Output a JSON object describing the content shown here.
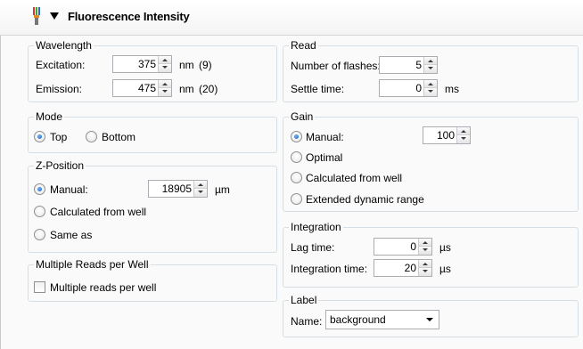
{
  "header": {
    "title": "Fluorescence Intensity"
  },
  "wavelength": {
    "legend": "Wavelength",
    "excitation_label": "Excitation:",
    "excitation_value": "375",
    "excitation_unit": "nm",
    "excitation_note": "(9)",
    "emission_label": "Emission:",
    "emission_value": "475",
    "emission_unit": "nm",
    "emission_note": "(20)"
  },
  "read": {
    "legend": "Read",
    "flashes_label": "Number of flashes:",
    "flashes_value": "5",
    "settle_label": "Settle time:",
    "settle_value": "0",
    "settle_unit": "ms"
  },
  "mode": {
    "legend": "Mode",
    "top_label": "Top",
    "bottom_label": "Bottom",
    "selected": "Top"
  },
  "gain": {
    "legend": "Gain",
    "manual_label": "Manual:",
    "manual_value": "100",
    "optimal_label": "Optimal",
    "calc_label": "Calculated from well",
    "extended_label": "Extended dynamic range",
    "selected": "Manual:"
  },
  "zposition": {
    "legend": "Z-Position",
    "manual_label": "Manual:",
    "manual_value": "18905",
    "unit": "µm",
    "calc_label": "Calculated from well",
    "same_label": "Same as",
    "selected": "Manual:"
  },
  "integration": {
    "legend": "Integration",
    "lag_label": "Lag time:",
    "lag_value": "0",
    "lag_unit": "µs",
    "time_label": "Integration time:",
    "time_value": "20",
    "time_unit": "µs"
  },
  "multiple_reads": {
    "legend": "Multiple Reads per Well",
    "checkbox_label": "Multiple reads per well",
    "checked": false
  },
  "label": {
    "legend": "Label",
    "name_label": "Name:",
    "name_value": "background"
  }
}
